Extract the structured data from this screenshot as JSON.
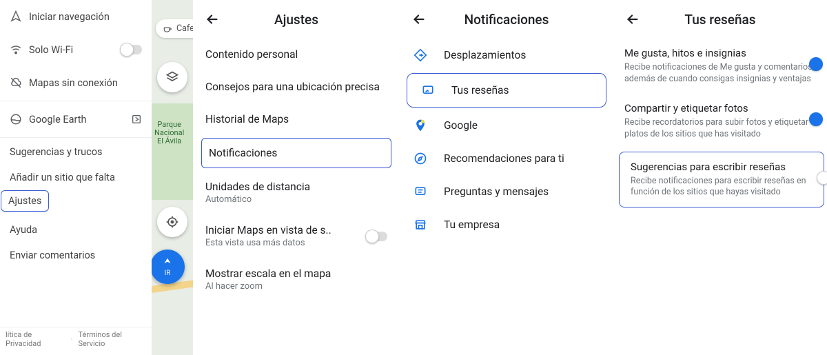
{
  "colors": {
    "accent": "#1a73e8",
    "highlight": "#3b5bd6"
  },
  "drawer": {
    "items": {
      "start_nav": "Iniciar navegación",
      "wifi_only": "Solo Wi-Fi",
      "offline_maps": "Mapas sin conexión",
      "google_earth": "Google Earth"
    },
    "plain": {
      "tips": "Sugerencias y trucos",
      "add_place": "Añadir un sitio que falta",
      "settings": "Ajustes",
      "help": "Ayuda",
      "feedback": "Enviar comentarios"
    },
    "footer": {
      "privacy": "lítica de Privacidad",
      "terms": "Términos del Servicio"
    }
  },
  "map": {
    "chip_label": "Cafet",
    "park1": "Parque",
    "park2": "Nacional",
    "park3": "El Ávila",
    "nav_fab": "IR"
  },
  "settings": {
    "title": "Ajustes",
    "rows": {
      "personal": "Contenido personal",
      "location_tips": "Consejos para una ubicación precisa",
      "history": "Historial de Maps",
      "notifications": "Notificaciones",
      "units_title": "Unidades de distancia",
      "units_sub": "Automático",
      "start_view_title": "Iniciar Maps en vista de s..",
      "start_view_sub": "Esta vista usa más datos",
      "scale_title": "Mostrar escala en el mapa",
      "scale_sub": "Al hacer zoom"
    }
  },
  "notifications": {
    "title": "Notificaciones",
    "items": {
      "commute": "Desplazamientos",
      "your_reviews": "Tus reseñas",
      "google": "Google",
      "recommendations": "Recomendaciones para ti",
      "qna": "Preguntas y mensajes",
      "business": "Tu empresa"
    }
  },
  "reviews": {
    "title": "Tus reseñas",
    "prefs": {
      "likes_title": "Me gusta, hitos e insignias",
      "likes_desc": "Recibe notificaciones de Me gusta y comentarios, además de cuando consigas insignias y ventajas",
      "share_title": "Compartir y etiquetar fotos",
      "share_desc": "Recibe recordatorios para subir fotos y etiquetar platos de los sitios que has visitado",
      "suggest_title": "Sugerencias para escribir reseñas",
      "suggest_desc": "Recibe notificaciones para escribir reseñas en función de los sitios que hayas visitado"
    }
  }
}
